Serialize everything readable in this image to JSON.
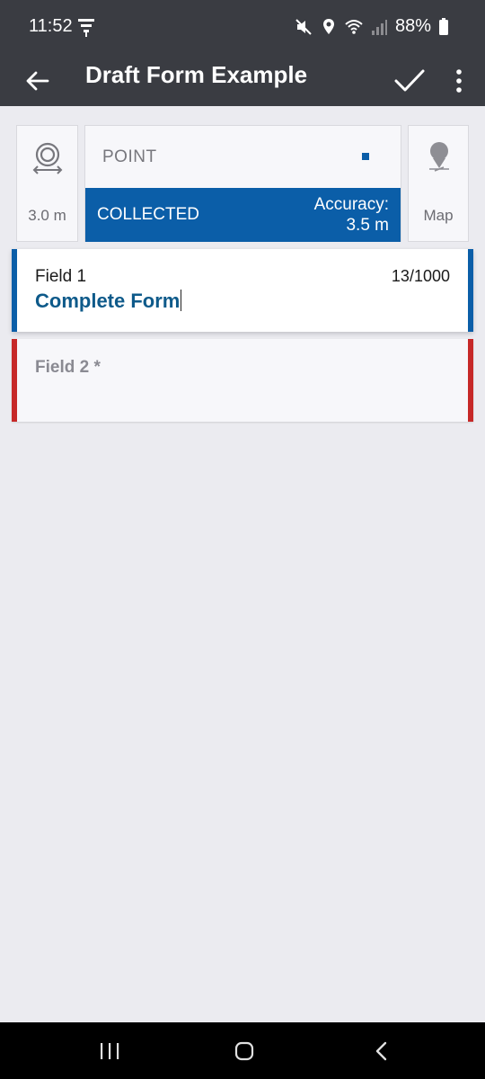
{
  "status_bar": {
    "time": "11:52",
    "battery_percent": "88%",
    "icons": [
      "antenna-icon",
      "mute-icon",
      "location-icon",
      "wifi-icon",
      "signal-icon",
      "battery-icon"
    ]
  },
  "app_bar": {
    "title": "Draft Form Example",
    "icons": [
      "back-arrow-icon",
      "checkmark-icon",
      "more-vert-icon"
    ]
  },
  "location": {
    "accuracy_setting": "3.0 m",
    "geometry_label": "POINT",
    "status_label": "COLLECTED",
    "accuracy_label": "Accuracy:",
    "accuracy_value": "3.5 m",
    "map_label": "Map",
    "accent_color": "#0b5ea8"
  },
  "fields": [
    {
      "label": "Field 1",
      "counter": "13/1000",
      "value": "Complete Form",
      "state": "active"
    },
    {
      "label": "Field 2 *",
      "value": "",
      "state": "required"
    }
  ],
  "colors": {
    "header": "#3a3c42",
    "active_border": "#0b5ea8",
    "required_border": "#c62828",
    "background": "#ebebf0"
  },
  "nav_bar": {
    "icons": [
      "recent-apps-icon",
      "home-icon",
      "back-icon"
    ]
  }
}
